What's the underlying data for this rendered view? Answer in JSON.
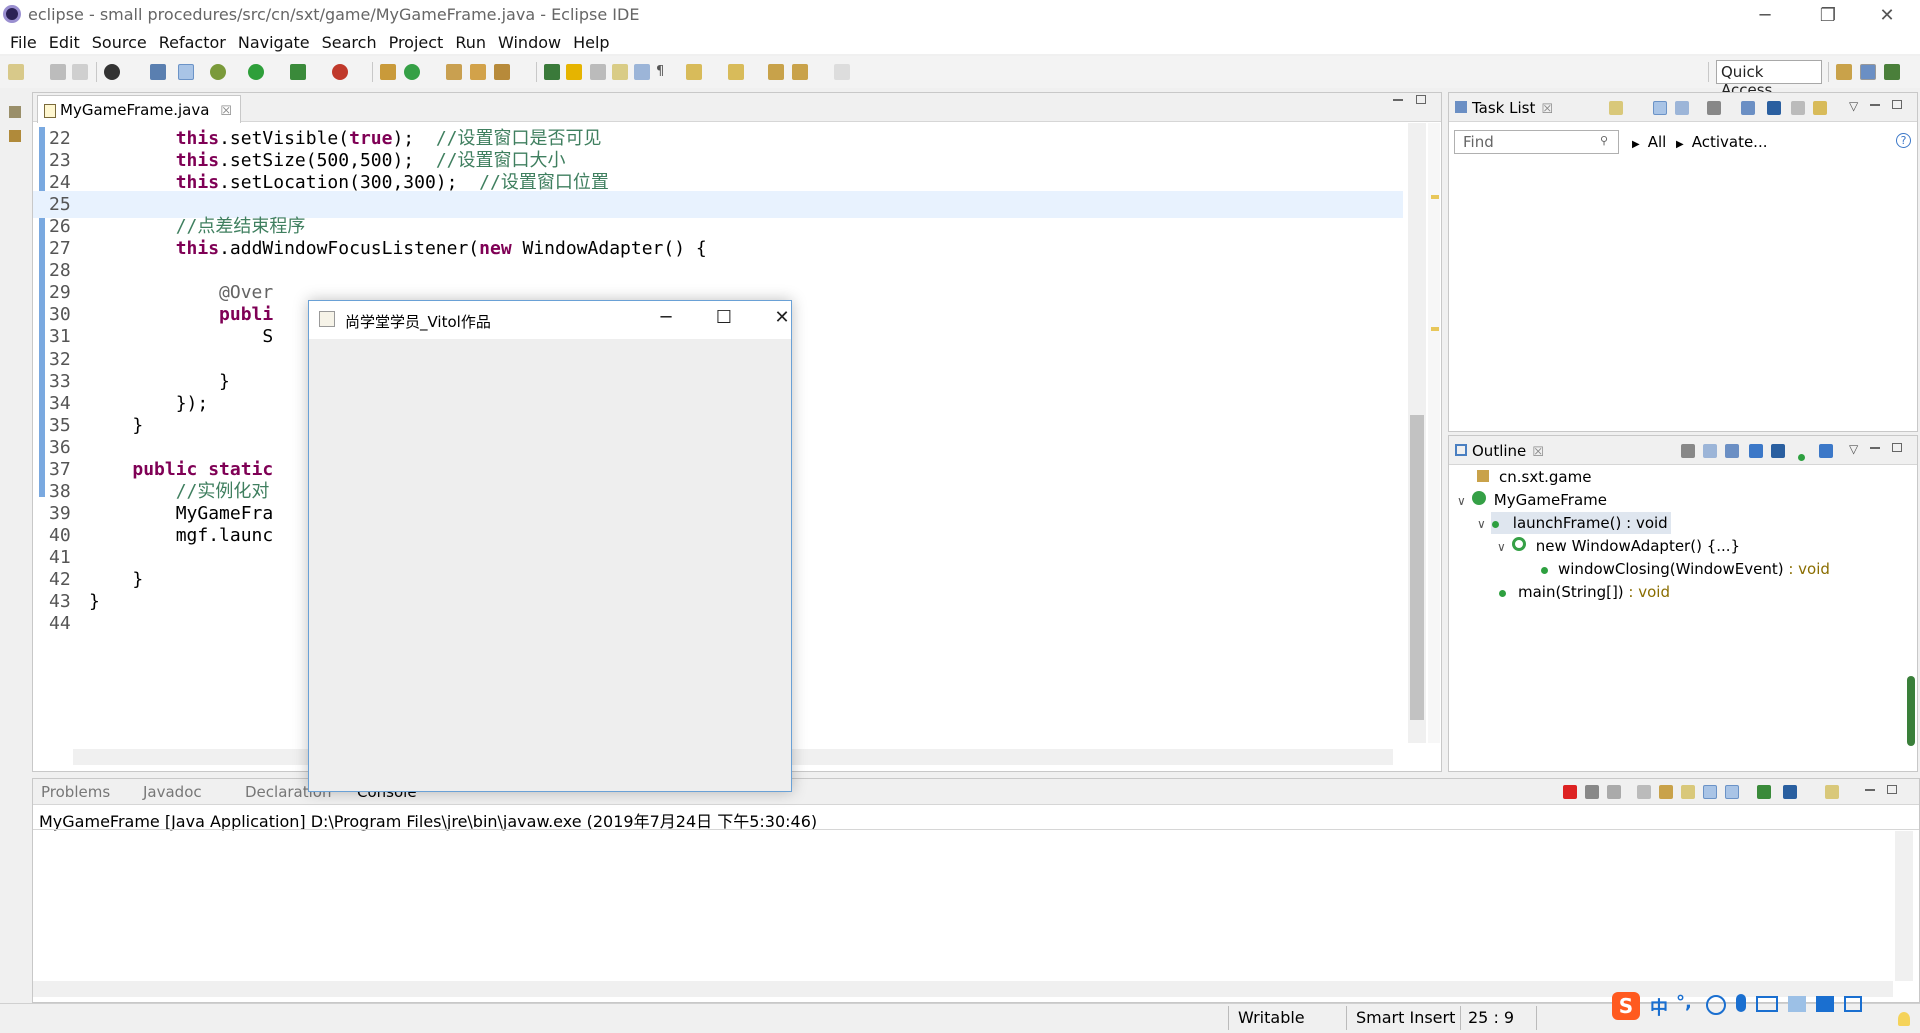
{
  "window": {
    "title": "eclipse - small procedures/src/cn/sxt/game/MyGameFrame.java - Eclipse IDE",
    "minimize": "─",
    "restore": "❐",
    "close": "✕"
  },
  "menu": [
    "File",
    "Edit",
    "Source",
    "Refactor",
    "Navigate",
    "Search",
    "Project",
    "Run",
    "Window",
    "Help"
  ],
  "toolbar": {
    "quick_access": "Quick Access"
  },
  "editor": {
    "tab_label": "MyGameFrame.java",
    "tab_close": "☒",
    "lines": [
      {
        "n": "22",
        "html": "        <span class=\"kw\">this</span>.setVisible(<span class=\"kw\">true</span>);  <span class=\"cm\">//设置窗口是否可见</span>"
      },
      {
        "n": "23",
        "html": "        <span class=\"kw\">this</span>.setSize(500,500);  <span class=\"cm\">//设置窗口大小</span>"
      },
      {
        "n": "24",
        "html": "        <span class=\"kw\">this</span>.setLocation(300,300);  <span class=\"cm\">//设置窗口位置</span>"
      },
      {
        "n": "25",
        "html": ""
      },
      {
        "n": "26",
        "html": "        <span class=\"cm\">//点差结束程序</span>"
      },
      {
        "n": "27",
        "html": "        <span class=\"kw\">this</span>.addWindowFocusListener(<span class=\"kw\">new</span> WindowAdapter() {"
      },
      {
        "n": "28",
        "html": ""
      },
      {
        "n": "29",
        "html": "            <span class=\"an\">@Over</span>"
      },
      {
        "n": "30",
        "html": "            <span class=\"kw\">publi</span>"
      },
      {
        "n": "31",
        "html": "                S"
      },
      {
        "n": "32",
        "html": ""
      },
      {
        "n": "33",
        "html": "            }"
      },
      {
        "n": "34",
        "html": "        });"
      },
      {
        "n": "35",
        "html": "    }"
      },
      {
        "n": "36",
        "html": ""
      },
      {
        "n": "37",
        "html": "    <span class=\"kw\">public static</span>"
      },
      {
        "n": "38",
        "html": "        <span class=\"cm\">//实例化对</span>"
      },
      {
        "n": "39",
        "html": "        MyGameFra"
      },
      {
        "n": "40",
        "html": "        mgf.launc"
      },
      {
        "n": "41",
        "html": ""
      },
      {
        "n": "42",
        "html": "    }"
      },
      {
        "n": "43",
        "html": "}"
      },
      {
        "n": "44",
        "html": ""
      }
    ]
  },
  "tasklist": {
    "tab_label": "Task List",
    "find_placeholder": "Find",
    "filter_all": "All",
    "activate": "Activate..."
  },
  "outline": {
    "tab_label": "Outline",
    "items": {
      "package": "cn.sxt.game",
      "class": "MyGameFrame",
      "method1": "launchFrame()",
      "method1_ret": " : void",
      "anon": "new WindowAdapter() {...}",
      "method2": "windowClosing(WindowEvent)",
      "method2_ret": " : void",
      "method3": "main(String[])",
      "method3_ret": " : void"
    }
  },
  "console": {
    "tabs": {
      "problems": "Problems",
      "javadoc": "Javadoc",
      "declaration": "Declaration",
      "console": "Console"
    },
    "description": "MyGameFrame [Java Application] D:\\Program Files\\jre\\bin\\javaw.exe (2019年7月24日 下午5:30:46)"
  },
  "statusbar": {
    "writable": "Writable",
    "insert_mode": "Smart Insert",
    "position": "25 : 9"
  },
  "java_window": {
    "title": "尚学堂学员_Vitol作品",
    "minimize": "─",
    "maximize": "☐",
    "close": "✕"
  },
  "ime": {
    "mode": "中"
  },
  "colors": {
    "keyword": "#7f0055",
    "comment": "#3f7f5f",
    "current_line": "#e8f2fe"
  }
}
